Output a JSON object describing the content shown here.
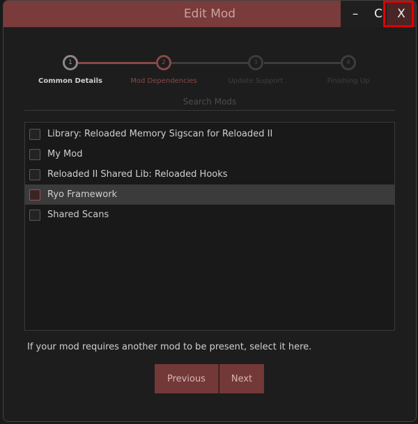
{
  "window": {
    "title": "Edit Mod",
    "controls": {
      "minimize": "–",
      "maximize": "C",
      "close": "X"
    }
  },
  "steps": [
    {
      "number": "1",
      "label": "Common Details",
      "state": "done"
    },
    {
      "number": "2",
      "label": "Mod Dependencies",
      "state": "current"
    },
    {
      "number": "3",
      "label": "Update Support",
      "state": "pending"
    },
    {
      "number": "4",
      "label": "Finishing Up",
      "state": "pending"
    }
  ],
  "search": {
    "label": "Search Mods"
  },
  "mods": [
    {
      "name": "Library: Reloaded Memory Sigscan for Reloaded II",
      "checked": false,
      "selected": false
    },
    {
      "name": "My Mod",
      "checked": false,
      "selected": false
    },
    {
      "name": "Reloaded II Shared Lib: Reloaded Hooks",
      "checked": false,
      "selected": false
    },
    {
      "name": "Ryo Framework",
      "checked": true,
      "selected": true
    },
    {
      "name": "Shared Scans",
      "checked": false,
      "selected": false
    }
  ],
  "hint": "If your mod requires another mod to be present, select it here.",
  "buttons": {
    "previous": "Previous",
    "next": "Next"
  },
  "colors": {
    "accent": "#7a3b3b",
    "close_highlight": "#e00000"
  }
}
